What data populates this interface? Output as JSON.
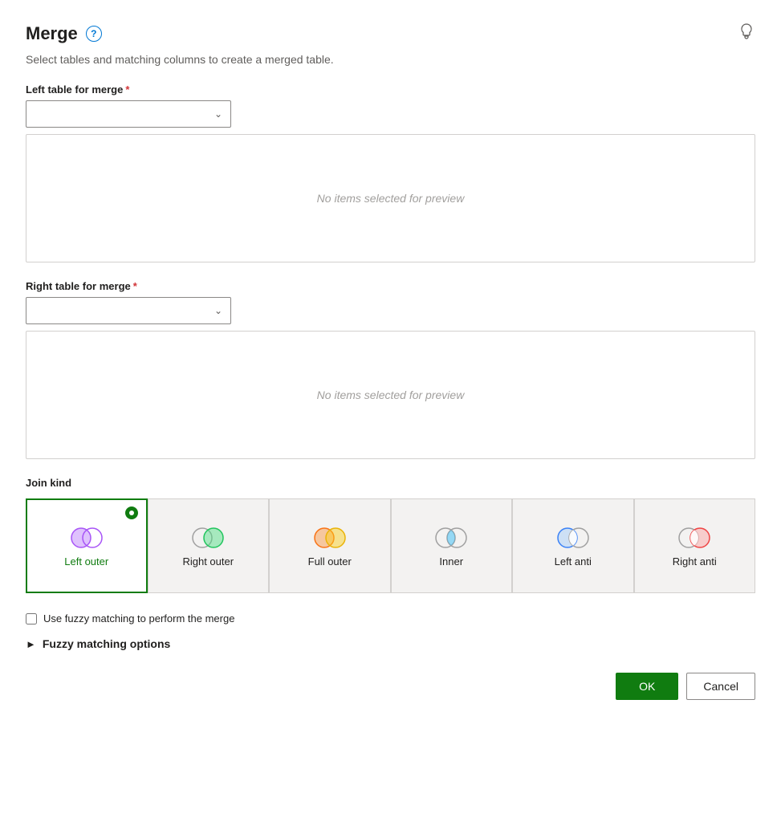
{
  "header": {
    "title": "Merge",
    "subtitle": "Select tables and matching columns to create a merged table.",
    "help_icon": "?",
    "lightbulb_icon": "💡"
  },
  "left_table": {
    "label": "Left table for merge",
    "required": true,
    "placeholder": "",
    "preview_empty": "No items selected for preview"
  },
  "right_table": {
    "label": "Right table for merge",
    "required": true,
    "placeholder": "",
    "preview_empty": "No items selected for preview"
  },
  "join_kind": {
    "label": "Join kind",
    "options": [
      {
        "id": "left-outer",
        "label": "Left outer",
        "selected": true
      },
      {
        "id": "right-outer",
        "label": "Right outer",
        "selected": false
      },
      {
        "id": "full-outer",
        "label": "Full outer",
        "selected": false
      },
      {
        "id": "inner",
        "label": "Inner",
        "selected": false
      },
      {
        "id": "left-anti",
        "label": "Left anti",
        "selected": false
      },
      {
        "id": "right-anti",
        "label": "Right anti",
        "selected": false
      }
    ]
  },
  "fuzzy": {
    "checkbox_label": "Use fuzzy matching to perform the merge",
    "options_label": "Fuzzy matching options"
  },
  "buttons": {
    "ok": "OK",
    "cancel": "Cancel"
  }
}
